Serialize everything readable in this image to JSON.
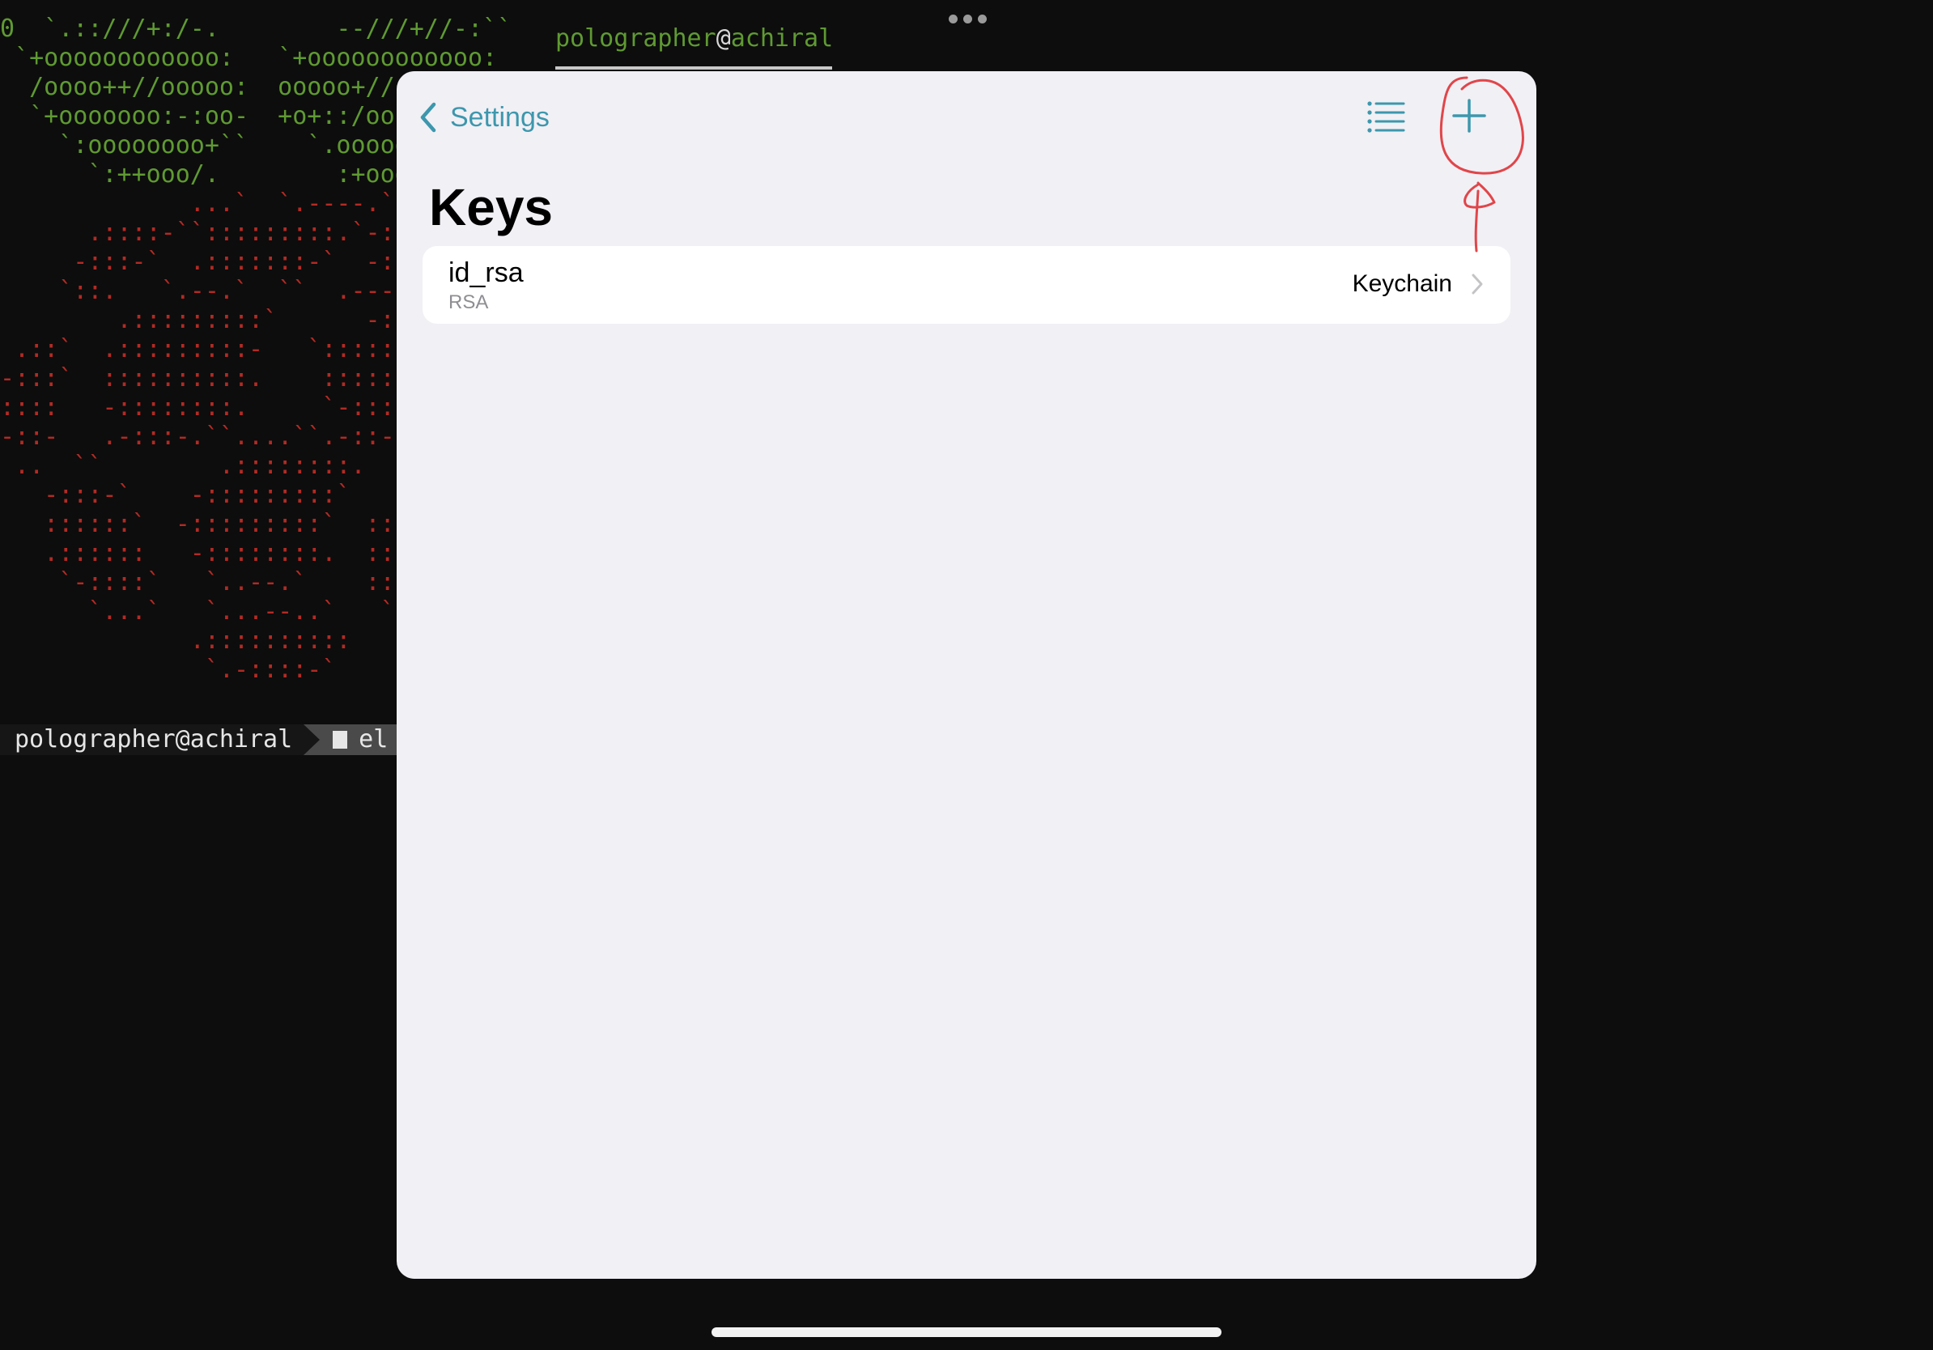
{
  "terminal": {
    "art_green": [
      "0  `.::///+:/-.        --///+//-:``   ",
      " `+oooooooooooo:   `+oooooooooooo:",
      "  /oooo++//ooooo:  ooooo+//",
      "  `+ooooooo:-:oo-  +o+::/oo",
      "    `:oooooooo+``    `.ooooo",
      "      `:++ooo/.        :+ooo"
    ],
    "art_red": [
      "             ...`  `.----.` ``..",
      "      .::::-``:::::::::.`-:::",
      "     -:::-`  .:::::::-`  -::",
      "    `::.   `.--.`  ``  .---.",
      "        .:::::::::`      -::::::",
      " .::`  .:::::::::-   `::::::",
      "-:::`  ::::::::::.    ::::::",
      "::::   -::::::::.     `-:::::",
      "-::-   .-:::-.``....``.-::-",
      " ..  ``        .::::::::.",
      "   -:::-`    -:::::::::`   .",
      "   ::::::`  -:::::::::`  ::",
      "   .::::::   -::::::::.  ::",
      "    `-::::`   `..--.`    ::",
      "      `...`   `...--..`   `.",
      "             .::::::::::",
      "              `.-::::-`"
    ],
    "neofetch_user": "polographer",
    "neofetch_at": "@",
    "neofetch_host": "achiral",
    "prompt_user": "polographer@achiral",
    "prompt_dir": "el"
  },
  "sheet": {
    "back_label": "Settings",
    "title": "Keys",
    "keys": [
      {
        "name": "id_rsa",
        "type": "RSA",
        "storage": "Keychain"
      }
    ]
  },
  "icons": {
    "back": "chevron-left-icon",
    "list": "list-icon",
    "add": "plus-icon",
    "disclosure": "chevron-right-icon"
  },
  "colors": {
    "accent": "#3d97ad",
    "sheet_background": "#f1f0f5",
    "terminal_background": "#0d0d0d",
    "terminal_green": "#5f9a32",
    "terminal_red": "#b42a24",
    "annotation": "#e0464a"
  }
}
